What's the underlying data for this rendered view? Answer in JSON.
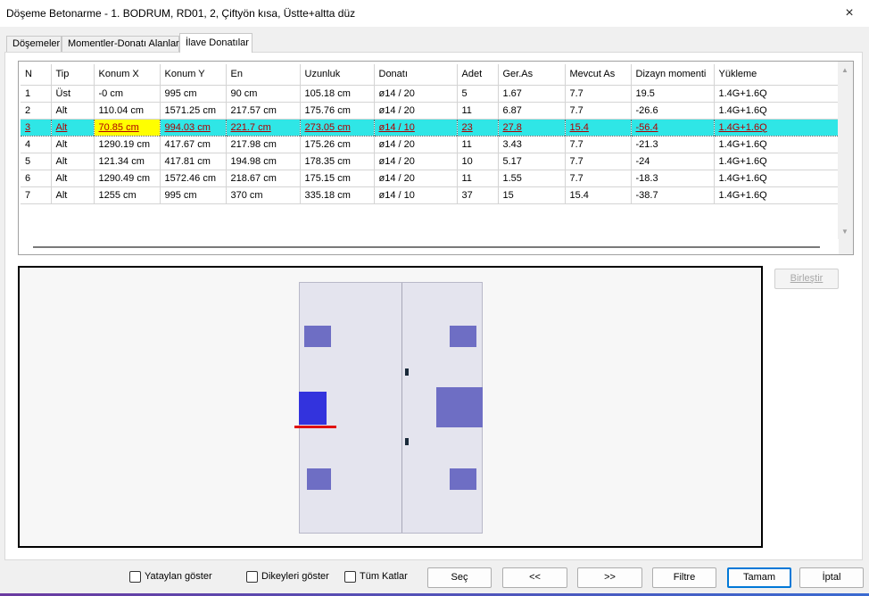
{
  "window": {
    "title": "Döşeme Betonarme - 1. BODRUM, RD01, 2, Çiftyön kısa, Üstte+altta düz",
    "close_icon": "×"
  },
  "tabs": [
    {
      "label": "Döşemeler"
    },
    {
      "label": "Momentler-Donatı Alanları"
    },
    {
      "label": "İlave Donatılar"
    }
  ],
  "table": {
    "columns": [
      "N",
      "Tip",
      "Konum X",
      "Konum Y",
      "En",
      "Uzunluk",
      "Donatı",
      "Adet",
      "Ger.As",
      "Mevcut As",
      "Dizayn momenti",
      "Yükleme"
    ],
    "rows": [
      [
        "1",
        "Üst",
        "-0 cm",
        "995 cm",
        "90 cm",
        "105.18 cm",
        "ø14 / 20",
        "5",
        "1.67",
        "7.7",
        "19.5",
        "1.4G+1.6Q"
      ],
      [
        "2",
        "Alt",
        "110.04 cm",
        "1571.25 cm",
        "217.57 cm",
        "175.76 cm",
        "ø14 / 20",
        "11",
        "6.87",
        "7.7",
        "-26.6",
        "1.4G+1.6Q"
      ],
      [
        "3",
        "Alt",
        "70.85 cm",
        "994.03 cm",
        "221.7 cm",
        "273.05 cm",
        "ø14 / 10",
        "23",
        "27.8",
        "15.4",
        "-56.4",
        "1.4G+1.6Q"
      ],
      [
        "4",
        "Alt",
        "1290.19 cm",
        "417.67 cm",
        "217.98 cm",
        "175.26 cm",
        "ø14 / 20",
        "11",
        "3.43",
        "7.7",
        "-21.3",
        "1.4G+1.6Q"
      ],
      [
        "5",
        "Alt",
        "121.34 cm",
        "417.81 cm",
        "194.98 cm",
        "178.35 cm",
        "ø14 / 20",
        "10",
        "5.17",
        "7.7",
        "-24",
        "1.4G+1.6Q"
      ],
      [
        "6",
        "Alt",
        "1290.49 cm",
        "1572.46 cm",
        "218.67 cm",
        "175.15 cm",
        "ø14 / 20",
        "11",
        "1.55",
        "7.7",
        "-18.3",
        "1.4G+1.6Q"
      ],
      [
        "7",
        "Alt",
        "1255 cm",
        "995 cm",
        "370 cm",
        "335.18 cm",
        "ø14 / 10",
        "37",
        "15",
        "15.4",
        "-38.7",
        "1.4G+1.6Q"
      ]
    ],
    "selected_row": 2,
    "highlight_cell": 2
  },
  "scrollbar": {
    "up_icon": "▲",
    "down_icon": "▼"
  },
  "buttons": {
    "birlestir": "Birleştir",
    "sec": "Seç",
    "prev": "<<",
    "next": ">>",
    "filtre": "Filtre",
    "tamam": "Tamam",
    "iptal": "İptal"
  },
  "checkboxes": {
    "yataylari": "Yataylan göster",
    "dikeyleri": "Dikeyleri göster",
    "tum_katlar": "Tüm Katlar"
  },
  "colors": {
    "selection_row": "#2fe6e6",
    "highlight_cell": "#ffff00",
    "rebar": "#6e6ec4",
    "rebar_selected": "#3333dd",
    "selection_marker": "#e01010",
    "primary_border": "#0078d7"
  }
}
